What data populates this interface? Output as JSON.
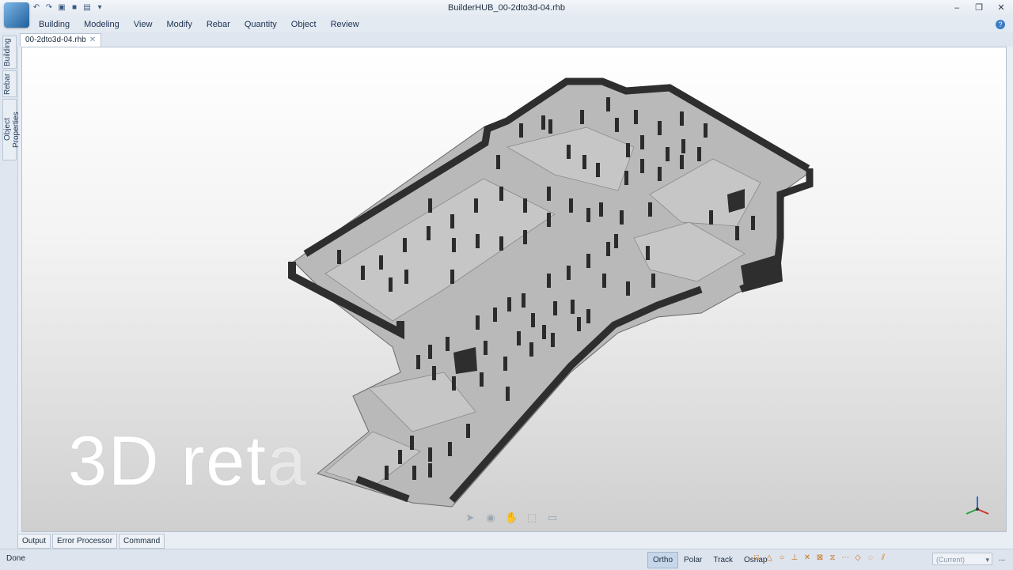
{
  "window": {
    "title": "BuilderHUB_00-2dto3d-04.rhb"
  },
  "quick_access": [
    "undo-icon",
    "redo-icon",
    "open-icon",
    "save-icon",
    "print-icon",
    "dropdown-icon"
  ],
  "menu": {
    "items": [
      "Building",
      "Modeling",
      "View",
      "Modify",
      "Rebar",
      "Quantity",
      "Object",
      "Review"
    ]
  },
  "side_tabs": [
    "Building",
    "Rebar",
    "Object Properties"
  ],
  "document_tab": {
    "label": "00-2dto3d-04.rhb"
  },
  "overlay": {
    "text_solid": "3D ret",
    "text_fade": "a"
  },
  "bottom_tabs": [
    "Output",
    "Error Processor",
    "Command"
  ],
  "status": {
    "text": "Done",
    "toggles": [
      {
        "label": "Ortho",
        "on": true
      },
      {
        "label": "Polar",
        "on": false
      },
      {
        "label": "Track",
        "on": false
      },
      {
        "label": "Osnap",
        "on": false
      }
    ],
    "layer_placeholder": "(Current)",
    "more": "..."
  },
  "colors": {
    "accent": "#3b7dc4",
    "wall": "#2e2e2e",
    "slab": "#b7b7b7"
  }
}
